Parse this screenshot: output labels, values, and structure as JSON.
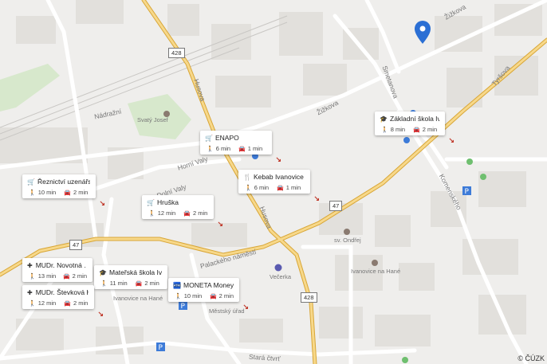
{
  "map": {
    "streets": [
      "Nádražní",
      "Husova",
      "Husova",
      "Žižkova",
      "Žižkova",
      "Smetanova",
      "Tyršova",
      "Komenského",
      "Horní Valy",
      "Dolní Valy",
      "Palackého náměstí",
      "Stará čtvrť"
    ],
    "places": [
      "Svatý Josef",
      "sv. Ondřej",
      "Večerka",
      "Ivanovice na Hané",
      "Ivanovice na Hané",
      "Městský úřad"
    ],
    "road_numbers": [
      "428",
      "428",
      "47",
      "47"
    ],
    "copyright": "© ČÚZK"
  },
  "pois": [
    {
      "icon": "cart-icon",
      "glyph": "🛒",
      "title": "ENAPO",
      "walk": "6 min",
      "drive": "1 min"
    },
    {
      "icon": "cart-icon",
      "glyph": "🛒",
      "title": "Řeznictví uzenářs…",
      "walk": "10 min",
      "drive": "2 min"
    },
    {
      "icon": "cart-icon",
      "glyph": "🛒",
      "title": "Hruška",
      "walk": "12 min",
      "drive": "2 min"
    },
    {
      "icon": "cutlery-icon",
      "glyph": "🍴",
      "title": "Kebab Ivanovice",
      "walk": "6 min",
      "drive": "1 min"
    },
    {
      "icon": "school-icon",
      "glyph": "🎓",
      "title": "Základní škola Iv…",
      "walk": "8 min",
      "drive": "2 min"
    },
    {
      "icon": "medical-icon",
      "glyph": "✚",
      "title": "MUDr. Novotná …",
      "walk": "13 min",
      "drive": "2 min"
    },
    {
      "icon": "school-icon",
      "glyph": "🎓",
      "title": "Mateřská škola Iv…",
      "walk": "11 min",
      "drive": "2 min"
    },
    {
      "icon": "medical-icon",
      "glyph": "✚",
      "title": "MUDr. Števková H…",
      "walk": "12 min",
      "drive": "2 min"
    },
    {
      "icon": "atm-icon",
      "glyph": "🏧",
      "title": "MONETA Money …",
      "walk": "10 min",
      "drive": "2 min"
    }
  ],
  "icons": {
    "walk": "🚶",
    "drive": "🚘",
    "arrow": "↘"
  }
}
